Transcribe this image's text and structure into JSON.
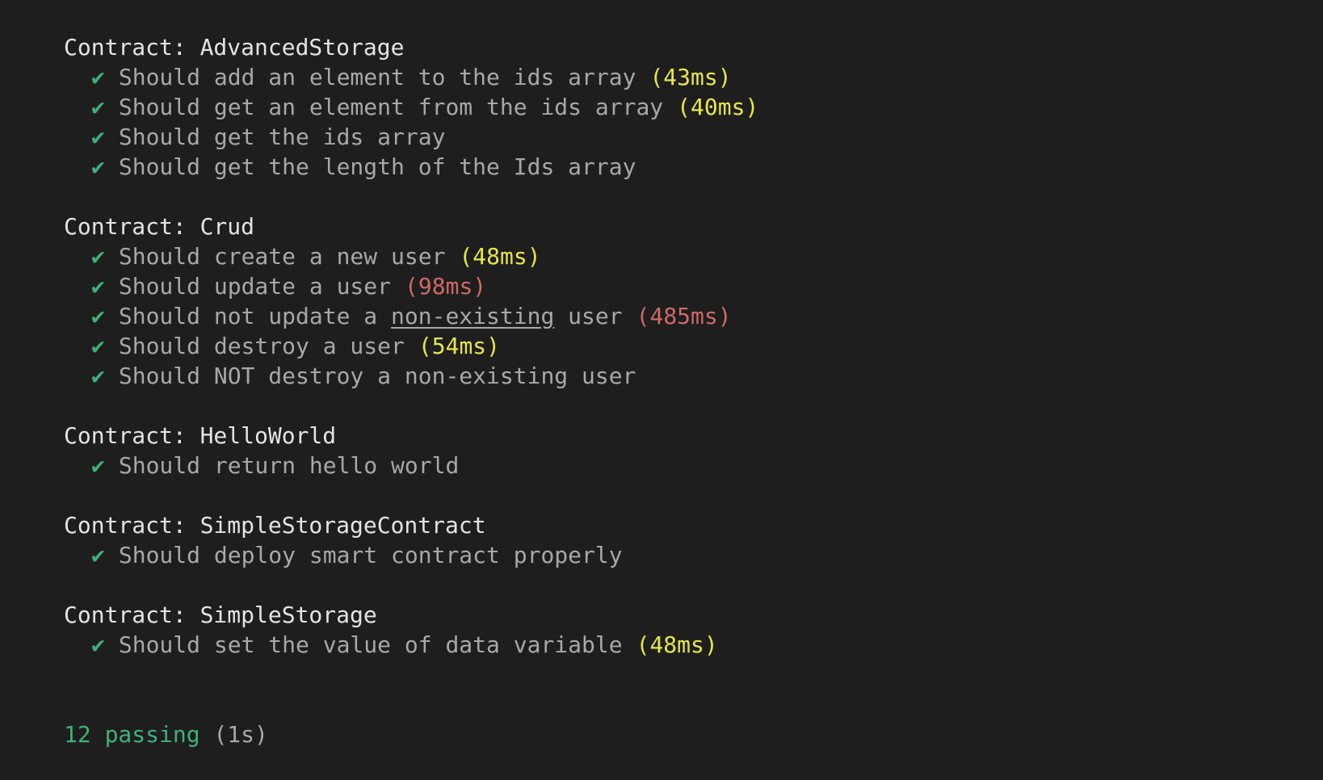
{
  "suites": [
    {
      "title": "Contract: AdvancedStorage",
      "tests": [
        {
          "check": "✔",
          "text": "Should add an element to the ids array",
          "duration": "(43ms)",
          "speed": "medium"
        },
        {
          "check": "✔",
          "text": "Should get an element from the ids array",
          "duration": "(40ms)",
          "speed": "medium"
        },
        {
          "check": "✔",
          "text": "Should get the ids array"
        },
        {
          "check": "✔",
          "text": "Should get the length of the Ids array"
        }
      ]
    },
    {
      "title": "Contract: Crud",
      "tests": [
        {
          "check": "✔",
          "text": "Should create a new user",
          "duration": "(48ms)",
          "speed": "medium"
        },
        {
          "check": "✔",
          "text": "Should update a user",
          "duration": "(98ms)",
          "speed": "slow"
        },
        {
          "check": "✔",
          "text_before": "Should not update a ",
          "text_link": "non-existing",
          "text_after": " user",
          "duration": "(485ms)",
          "speed": "slow"
        },
        {
          "check": "✔",
          "text": "Should destroy a user",
          "duration": "(54ms)",
          "speed": "medium"
        },
        {
          "check": "✔",
          "text": "Should NOT destroy a non-existing user"
        }
      ]
    },
    {
      "title": "Contract: HelloWorld",
      "tests": [
        {
          "check": "✔",
          "text": "Should return hello world"
        }
      ]
    },
    {
      "title": "Contract: SimpleStorageContract",
      "tests": [
        {
          "check": "✔",
          "text": "Should deploy smart contract properly"
        }
      ]
    },
    {
      "title": "Contract: SimpleStorage",
      "tests": [
        {
          "check": "✔",
          "text": "Should set the value of data variable",
          "duration": "(48ms)",
          "speed": "medium"
        }
      ]
    }
  ],
  "summary": {
    "passing": "12 passing",
    "elapsed": "(1s)"
  },
  "colors": {
    "background": "#1e1e1e",
    "pass": "#3fb07a",
    "medium": "#e6e64a",
    "slow": "#d06868",
    "text": "#a8a8a8",
    "title": "#e4e4e4"
  }
}
